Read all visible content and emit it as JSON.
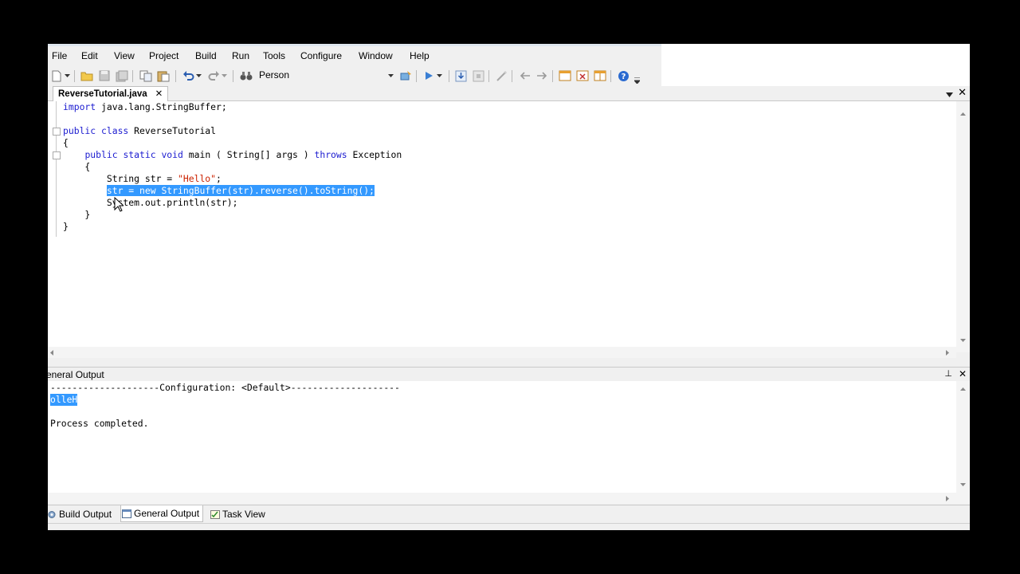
{
  "menu": [
    "File",
    "Edit",
    "View",
    "Project",
    "Build",
    "Run",
    "Tools",
    "Configure",
    "Window",
    "Help"
  ],
  "toolbar": {
    "target_combo": "Person"
  },
  "editor": {
    "tab_label": "ReverseTutorial.java",
    "tab_close": "✕",
    "code_lines": [
      "import java.lang.StringBuffer;",
      "",
      "public class ReverseTutorial",
      "{",
      "    public static void main ( String[] args ) throws Exception",
      "    {",
      "        String str = \"Hello\";",
      "        str = new StringBuffer(str).reverse().toString();",
      "        System.out.println(str);",
      "    }",
      "}"
    ]
  },
  "output_panel": {
    "title": "eneral Output",
    "pin": "⊥",
    "close": "✕",
    "lines": [
      "--------------------Configuration: <Default>--------------------",
      "olleH",
      "",
      "Process completed."
    ]
  },
  "bottom_tabs": [
    "Build Output",
    "General Output",
    "Task View"
  ],
  "colors": {
    "keyword": "#1c1cd0",
    "string": "#cc2200",
    "selection": "#3399ff"
  }
}
